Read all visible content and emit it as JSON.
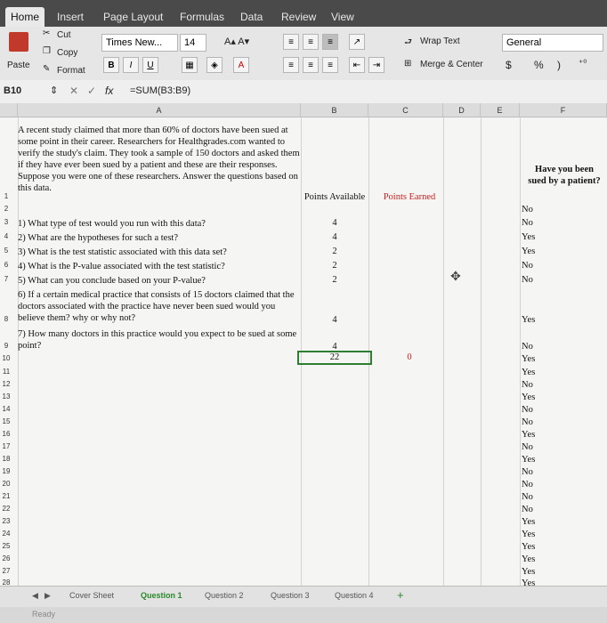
{
  "ribbon_tabs": [
    "Home",
    "Insert",
    "Page Layout",
    "Formulas",
    "Data",
    "Review",
    "View"
  ],
  "clipboard": {
    "cut": "Cut",
    "copy": "Copy",
    "paste": "Paste",
    "format": "Format"
  },
  "font": {
    "name": "Times New...",
    "size": "14",
    "bold": "B",
    "italic": "I",
    "underline": "U"
  },
  "alignment": {
    "wrap_text": "Wrap Text",
    "merge_center": "Merge & Center"
  },
  "number": {
    "format": "General",
    "currency": "$",
    "percent": "%",
    "comma": ")"
  },
  "formula_bar": {
    "cell_ref": "B10",
    "fx": "fx",
    "formula": "=SUM(B3:B9)"
  },
  "columns": [
    "A",
    "B",
    "C",
    "D",
    "E",
    "F"
  ],
  "intro": "A recent study claimed that more than 60% of doctors have been sued at some point in their career. Researchers for Healthgrades.com wanted to verify the study's claim. They took a sample of 150 doctors and asked them if they have ever been sued by a patient and these are their responses. Suppose you were one of these researchers. Answer the questions based on this data.",
  "headers": {
    "points_available": "Points Available",
    "points_earned": "Points Earned",
    "survey_question": "Have you been sued by a patient?"
  },
  "questions": [
    {
      "text": "1) What type of test would you run with this data?",
      "points": "4"
    },
    {
      "text": "2) What are the hypotheses for such a test?",
      "points": "4"
    },
    {
      "text": "3) What is the test statistic associated with this data set?",
      "points": "2"
    },
    {
      "text": "4) What is the P-value associated with the test statistic?",
      "points": "2"
    },
    {
      "text": "5) What can you conclude based on your P-value?",
      "points": "2"
    },
    {
      "text": "6) If a certain medical practice that consists of 15 doctors claimed that the doctors associated with the practice have never been sued would you believe them? why or why not?",
      "points": "4"
    },
    {
      "text": "7) How many doctors in this practice would you expect to be sued at some point?",
      "points": "4"
    }
  ],
  "totals": {
    "available": "22",
    "earned": "0"
  },
  "responses": [
    "No",
    "No",
    "Yes",
    "Yes",
    "No",
    "No",
    "Yes",
    "No",
    "Yes",
    "Yes",
    "No",
    "Yes",
    "No",
    "No",
    "Yes",
    "No",
    "Yes",
    "No",
    "No",
    "No",
    "No",
    "Yes",
    "Yes",
    "Yes",
    "Yes",
    "Yes",
    "Yes"
  ],
  "row_numbers": [
    "1",
    "2",
    "3",
    "4",
    "5",
    "6",
    "7",
    "8",
    "9",
    "10",
    "11",
    "12",
    "13",
    "14",
    "15",
    "16",
    "17",
    "18",
    "19",
    "20",
    "21",
    "22",
    "23",
    "24",
    "25",
    "26",
    "27",
    "28"
  ],
  "sheet_tabs": [
    "Cover Sheet",
    "Question 1",
    "Question 2",
    "Question 3",
    "Question 4"
  ],
  "active_sheet": "Question 1",
  "status": "Ready",
  "colors": {
    "red_header": "#cc2222",
    "active_tab": "#2a8a2a",
    "selected_border": "#2e7d32"
  }
}
